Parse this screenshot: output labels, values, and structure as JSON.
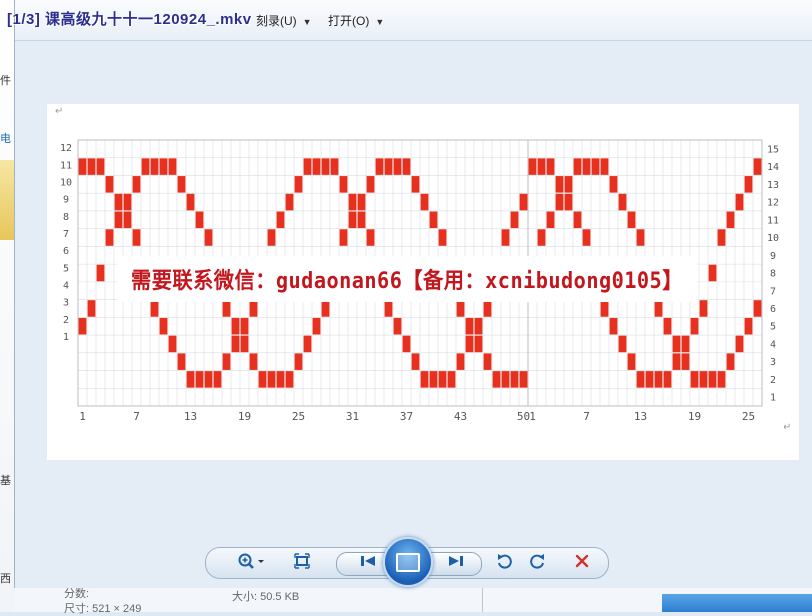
{
  "window": {
    "title": "[1/3] 课高级九十十一120924_.mkv"
  },
  "menu": {
    "items": [
      {
        "label": "刻录(U)"
      },
      {
        "label": "打开(O)"
      }
    ]
  },
  "background": {
    "left_peeks": [
      "件",
      "电",
      "基",
      "西"
    ],
    "bottom_texts": [
      "分数: ",
      "尺寸: 521 × 249",
      "大小: 50.5 KB"
    ]
  },
  "image": {
    "banner": "需要联系微信：gudaonan66【备用：xcnibudong0105】",
    "left_axis": [
      "12",
      "11",
      "10",
      "9",
      "8",
      "7",
      "6",
      "5",
      "4",
      "3",
      "2",
      "1"
    ],
    "right_axis": [
      "15",
      "14",
      "13",
      "12",
      "11",
      "10",
      "9",
      "8",
      "7",
      "6",
      "5",
      "4",
      "3",
      "2",
      "1"
    ],
    "bottom_axis": [
      "1",
      "7",
      "13",
      "19",
      "25",
      "31",
      "37",
      "43",
      "50",
      "1",
      "7",
      "13",
      "19",
      "25"
    ],
    "colors": {
      "red": "#e8301f",
      "orange": "#f4a26a",
      "gray": "#a4a4a4",
      "lavender": "#a8a3f0",
      "magenta": "#e24be0",
      "grid": "#d9dde2"
    }
  },
  "controls": {
    "zoom_icon": "zoom-icon",
    "fit_icon": "fit-to-window-icon",
    "prev_icon": "previous-icon",
    "slideshow_icon": "slideshow-icon",
    "next_icon": "next-icon",
    "rotate_ccw_icon": "rotate-counterclockwise-icon",
    "rotate_cw_icon": "rotate-clockwise-icon",
    "delete_icon": "delete-icon"
  }
}
